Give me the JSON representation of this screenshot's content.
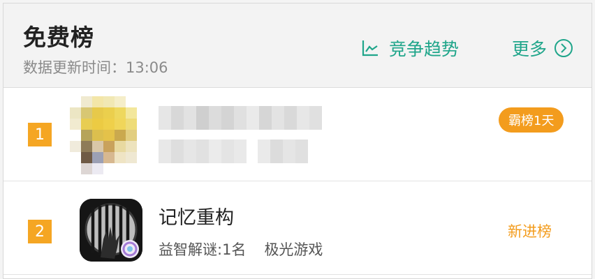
{
  "header": {
    "title": "免费榜",
    "updated_label": "数据更新时间：",
    "updated_time": "13:06",
    "trend_label": "竞争趋势",
    "more_label": "更多"
  },
  "icons": {
    "trend": "line-chart-icon",
    "more": "chevron-right-circle-icon"
  },
  "rows": [
    {
      "rank": "1",
      "name": "",
      "meta": "",
      "badge": "霸榜1天",
      "blurred": true
    },
    {
      "rank": "2",
      "name": "记忆重构",
      "category": "益智解谜:1名",
      "developer": "极光游戏",
      "badge": "新进榜",
      "blurred": false
    }
  ],
  "colors": {
    "accent": "#1fa58a",
    "rank_bg": "#f5a623",
    "badge": "#f39c1d"
  }
}
